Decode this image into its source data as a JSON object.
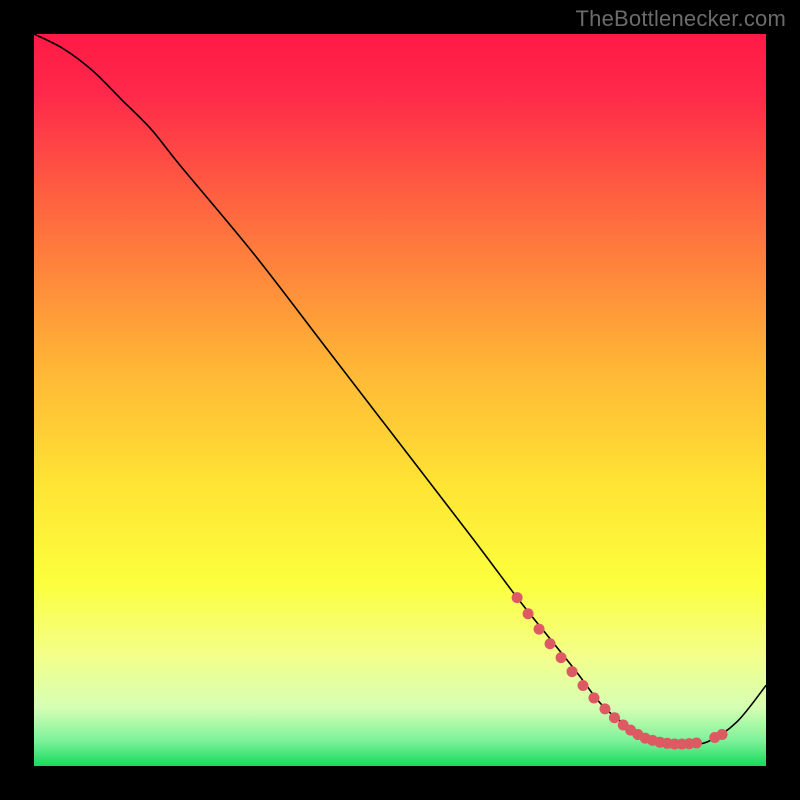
{
  "watermark": "TheBottlenecker.com",
  "chart_data": {
    "type": "line",
    "title": "",
    "xlabel": "",
    "ylabel": "",
    "xlim": [
      0,
      100
    ],
    "ylim": [
      0,
      100
    ],
    "background_gradient": {
      "stops": [
        {
          "offset": 0.0,
          "color": "#ff1a45"
        },
        {
          "offset": 0.08,
          "color": "#ff284a"
        },
        {
          "offset": 0.25,
          "color": "#ff6b3f"
        },
        {
          "offset": 0.45,
          "color": "#ffb436"
        },
        {
          "offset": 0.62,
          "color": "#ffe534"
        },
        {
          "offset": 0.75,
          "color": "#fcff3d"
        },
        {
          "offset": 0.85,
          "color": "#f3ff8b"
        },
        {
          "offset": 0.92,
          "color": "#d6ffb3"
        },
        {
          "offset": 0.965,
          "color": "#7ef29a"
        },
        {
          "offset": 1.0,
          "color": "#18d95e"
        }
      ]
    },
    "series": [
      {
        "name": "bottleneck-curve",
        "color": "#000000",
        "stroke_width": 1.6,
        "x": [
          0,
          4,
          8,
          12,
          16,
          20,
          30,
          40,
          50,
          60,
          66,
          70,
          74,
          77,
          79,
          81,
          83,
          85,
          87,
          89,
          92,
          96,
          100
        ],
        "y": [
          100,
          98,
          95,
          91,
          87,
          82,
          70,
          57,
          44,
          31,
          23,
          18,
          13,
          9,
          7,
          5.5,
          4.2,
          3.4,
          3,
          3,
          3.3,
          6,
          11
        ]
      }
    ],
    "markers": {
      "color": "#dd5a63",
      "radius": 5.5,
      "points": [
        {
          "x": 66.0,
          "y": 23.0
        },
        {
          "x": 67.5,
          "y": 20.8
        },
        {
          "x": 69.0,
          "y": 18.7
        },
        {
          "x": 70.5,
          "y": 16.7
        },
        {
          "x": 72.0,
          "y": 14.8
        },
        {
          "x": 73.5,
          "y": 12.9
        },
        {
          "x": 75.0,
          "y": 11.0
        },
        {
          "x": 76.5,
          "y": 9.3
        },
        {
          "x": 78.0,
          "y": 7.8
        },
        {
          "x": 79.3,
          "y": 6.6
        },
        {
          "x": 80.5,
          "y": 5.6
        },
        {
          "x": 81.5,
          "y": 4.9
        },
        {
          "x": 82.5,
          "y": 4.3
        },
        {
          "x": 83.5,
          "y": 3.8
        },
        {
          "x": 84.5,
          "y": 3.5
        },
        {
          "x": 85.5,
          "y": 3.25
        },
        {
          "x": 86.5,
          "y": 3.1
        },
        {
          "x": 87.5,
          "y": 3.0
        },
        {
          "x": 88.5,
          "y": 3.0
        },
        {
          "x": 89.5,
          "y": 3.05
        },
        {
          "x": 90.5,
          "y": 3.15
        },
        {
          "x": 93.0,
          "y": 3.9
        },
        {
          "x": 94.0,
          "y": 4.3
        }
      ]
    }
  }
}
